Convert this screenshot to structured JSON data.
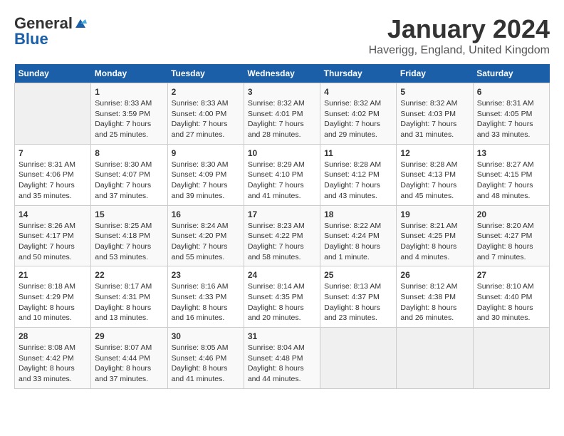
{
  "header": {
    "logo_general": "General",
    "logo_blue": "Blue",
    "month": "January 2024",
    "location": "Haverigg, England, United Kingdom"
  },
  "weekdays": [
    "Sunday",
    "Monday",
    "Tuesday",
    "Wednesday",
    "Thursday",
    "Friday",
    "Saturday"
  ],
  "weeks": [
    [
      {
        "day": "",
        "sunrise": "",
        "sunset": "",
        "daylight": ""
      },
      {
        "day": "1",
        "sunrise": "Sunrise: 8:33 AM",
        "sunset": "Sunset: 3:59 PM",
        "daylight": "Daylight: 7 hours and 25 minutes."
      },
      {
        "day": "2",
        "sunrise": "Sunrise: 8:33 AM",
        "sunset": "Sunset: 4:00 PM",
        "daylight": "Daylight: 7 hours and 27 minutes."
      },
      {
        "day": "3",
        "sunrise": "Sunrise: 8:32 AM",
        "sunset": "Sunset: 4:01 PM",
        "daylight": "Daylight: 7 hours and 28 minutes."
      },
      {
        "day": "4",
        "sunrise": "Sunrise: 8:32 AM",
        "sunset": "Sunset: 4:02 PM",
        "daylight": "Daylight: 7 hours and 29 minutes."
      },
      {
        "day": "5",
        "sunrise": "Sunrise: 8:32 AM",
        "sunset": "Sunset: 4:03 PM",
        "daylight": "Daylight: 7 hours and 31 minutes."
      },
      {
        "day": "6",
        "sunrise": "Sunrise: 8:31 AM",
        "sunset": "Sunset: 4:05 PM",
        "daylight": "Daylight: 7 hours and 33 minutes."
      }
    ],
    [
      {
        "day": "7",
        "sunrise": "Sunrise: 8:31 AM",
        "sunset": "Sunset: 4:06 PM",
        "daylight": "Daylight: 7 hours and 35 minutes."
      },
      {
        "day": "8",
        "sunrise": "Sunrise: 8:30 AM",
        "sunset": "Sunset: 4:07 PM",
        "daylight": "Daylight: 7 hours and 37 minutes."
      },
      {
        "day": "9",
        "sunrise": "Sunrise: 8:30 AM",
        "sunset": "Sunset: 4:09 PM",
        "daylight": "Daylight: 7 hours and 39 minutes."
      },
      {
        "day": "10",
        "sunrise": "Sunrise: 8:29 AM",
        "sunset": "Sunset: 4:10 PM",
        "daylight": "Daylight: 7 hours and 41 minutes."
      },
      {
        "day": "11",
        "sunrise": "Sunrise: 8:28 AM",
        "sunset": "Sunset: 4:12 PM",
        "daylight": "Daylight: 7 hours and 43 minutes."
      },
      {
        "day": "12",
        "sunrise": "Sunrise: 8:28 AM",
        "sunset": "Sunset: 4:13 PM",
        "daylight": "Daylight: 7 hours and 45 minutes."
      },
      {
        "day": "13",
        "sunrise": "Sunrise: 8:27 AM",
        "sunset": "Sunset: 4:15 PM",
        "daylight": "Daylight: 7 hours and 48 minutes."
      }
    ],
    [
      {
        "day": "14",
        "sunrise": "Sunrise: 8:26 AM",
        "sunset": "Sunset: 4:17 PM",
        "daylight": "Daylight: 7 hours and 50 minutes."
      },
      {
        "day": "15",
        "sunrise": "Sunrise: 8:25 AM",
        "sunset": "Sunset: 4:18 PM",
        "daylight": "Daylight: 7 hours and 53 minutes."
      },
      {
        "day": "16",
        "sunrise": "Sunrise: 8:24 AM",
        "sunset": "Sunset: 4:20 PM",
        "daylight": "Daylight: 7 hours and 55 minutes."
      },
      {
        "day": "17",
        "sunrise": "Sunrise: 8:23 AM",
        "sunset": "Sunset: 4:22 PM",
        "daylight": "Daylight: 7 hours and 58 minutes."
      },
      {
        "day": "18",
        "sunrise": "Sunrise: 8:22 AM",
        "sunset": "Sunset: 4:24 PM",
        "daylight": "Daylight: 8 hours and 1 minute."
      },
      {
        "day": "19",
        "sunrise": "Sunrise: 8:21 AM",
        "sunset": "Sunset: 4:25 PM",
        "daylight": "Daylight: 8 hours and 4 minutes."
      },
      {
        "day": "20",
        "sunrise": "Sunrise: 8:20 AM",
        "sunset": "Sunset: 4:27 PM",
        "daylight": "Daylight: 8 hours and 7 minutes."
      }
    ],
    [
      {
        "day": "21",
        "sunrise": "Sunrise: 8:18 AM",
        "sunset": "Sunset: 4:29 PM",
        "daylight": "Daylight: 8 hours and 10 minutes."
      },
      {
        "day": "22",
        "sunrise": "Sunrise: 8:17 AM",
        "sunset": "Sunset: 4:31 PM",
        "daylight": "Daylight: 8 hours and 13 minutes."
      },
      {
        "day": "23",
        "sunrise": "Sunrise: 8:16 AM",
        "sunset": "Sunset: 4:33 PM",
        "daylight": "Daylight: 8 hours and 16 minutes."
      },
      {
        "day": "24",
        "sunrise": "Sunrise: 8:14 AM",
        "sunset": "Sunset: 4:35 PM",
        "daylight": "Daylight: 8 hours and 20 minutes."
      },
      {
        "day": "25",
        "sunrise": "Sunrise: 8:13 AM",
        "sunset": "Sunset: 4:37 PM",
        "daylight": "Daylight: 8 hours and 23 minutes."
      },
      {
        "day": "26",
        "sunrise": "Sunrise: 8:12 AM",
        "sunset": "Sunset: 4:38 PM",
        "daylight": "Daylight: 8 hours and 26 minutes."
      },
      {
        "day": "27",
        "sunrise": "Sunrise: 8:10 AM",
        "sunset": "Sunset: 4:40 PM",
        "daylight": "Daylight: 8 hours and 30 minutes."
      }
    ],
    [
      {
        "day": "28",
        "sunrise": "Sunrise: 8:08 AM",
        "sunset": "Sunset: 4:42 PM",
        "daylight": "Daylight: 8 hours and 33 minutes."
      },
      {
        "day": "29",
        "sunrise": "Sunrise: 8:07 AM",
        "sunset": "Sunset: 4:44 PM",
        "daylight": "Daylight: 8 hours and 37 minutes."
      },
      {
        "day": "30",
        "sunrise": "Sunrise: 8:05 AM",
        "sunset": "Sunset: 4:46 PM",
        "daylight": "Daylight: 8 hours and 41 minutes."
      },
      {
        "day": "31",
        "sunrise": "Sunrise: 8:04 AM",
        "sunset": "Sunset: 4:48 PM",
        "daylight": "Daylight: 8 hours and 44 minutes."
      },
      {
        "day": "",
        "sunrise": "",
        "sunset": "",
        "daylight": ""
      },
      {
        "day": "",
        "sunrise": "",
        "sunset": "",
        "daylight": ""
      },
      {
        "day": "",
        "sunrise": "",
        "sunset": "",
        "daylight": ""
      }
    ]
  ]
}
